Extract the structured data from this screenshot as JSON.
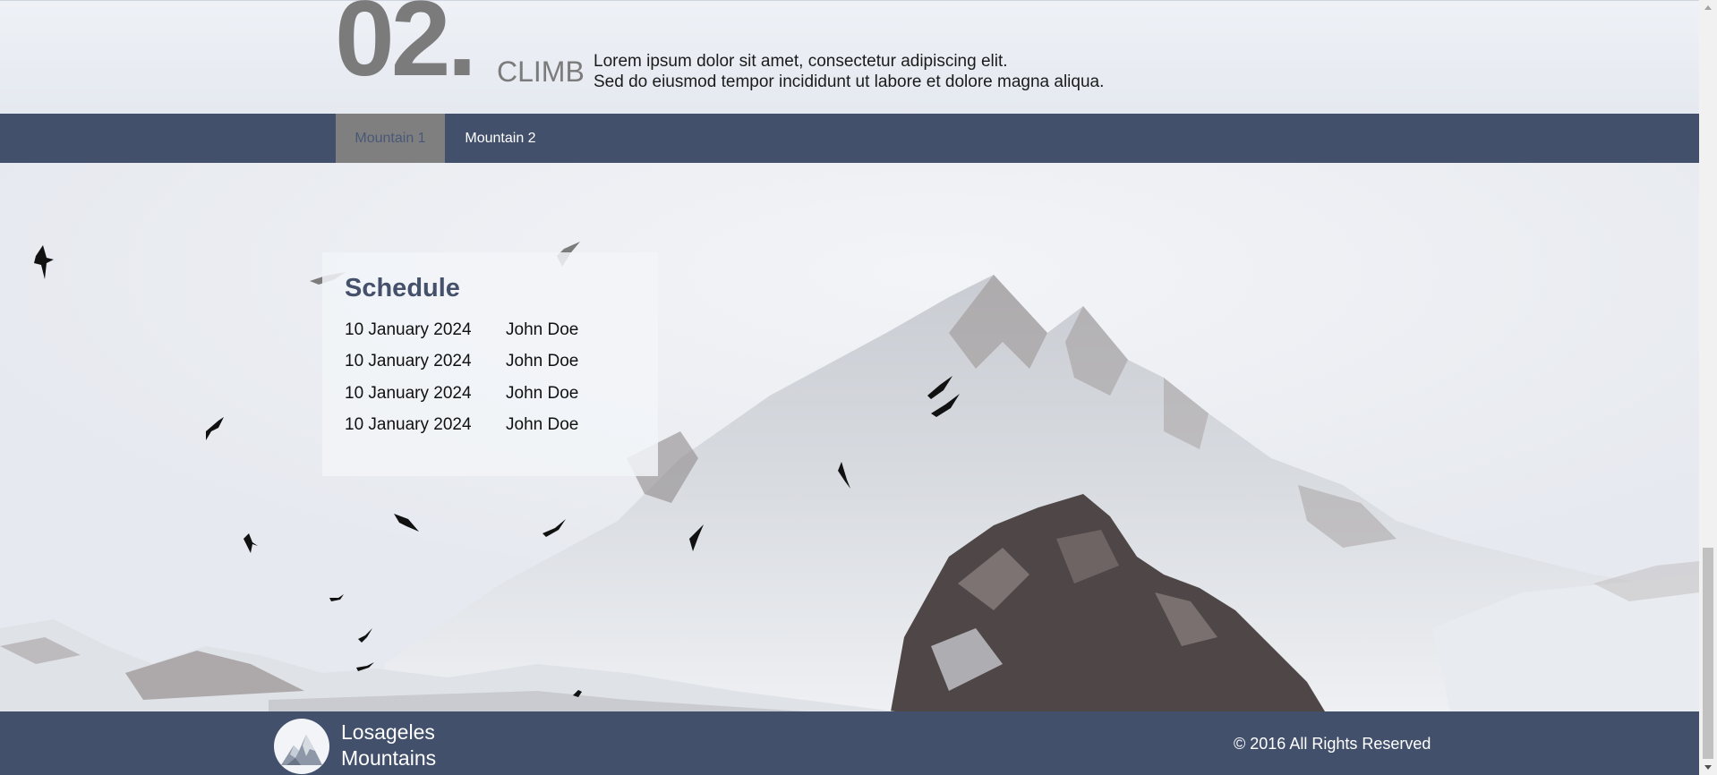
{
  "header": {
    "number": "02.",
    "label": "CLIMB",
    "text_line1": "Lorem ipsum dolor sit amet, consectetur adipiscing elit.",
    "text_line2": "Sed do eiusmod tempor incididunt ut labore et dolore magna aliqua."
  },
  "nav": {
    "tabs": [
      {
        "label": "Mountain 1"
      },
      {
        "label": "Mountain 2"
      }
    ]
  },
  "schedule": {
    "title": "Schedule",
    "rows": [
      {
        "date": "10 January 2024",
        "name": "John Doe"
      },
      {
        "date": "10 January 2024",
        "name": "John Doe"
      },
      {
        "date": "10 January 2024",
        "name": "John Doe"
      },
      {
        "date": "10 January 2024",
        "name": "John Doe"
      }
    ]
  },
  "footer": {
    "brand_line1": "Losageles",
    "brand_line2": "Mountains",
    "copyright": "© 2016 All Rights Reserved"
  },
  "colors": {
    "nav_bg": "#42506c",
    "active_tab_bg": "#7f7f7f",
    "heading_gray": "#7b7b7b",
    "schedule_title": "#45506a"
  },
  "icons": {
    "logo": "mountain-logo-icon",
    "scroll_up": "triangle-up-icon",
    "scroll_down": "triangle-down-icon"
  }
}
